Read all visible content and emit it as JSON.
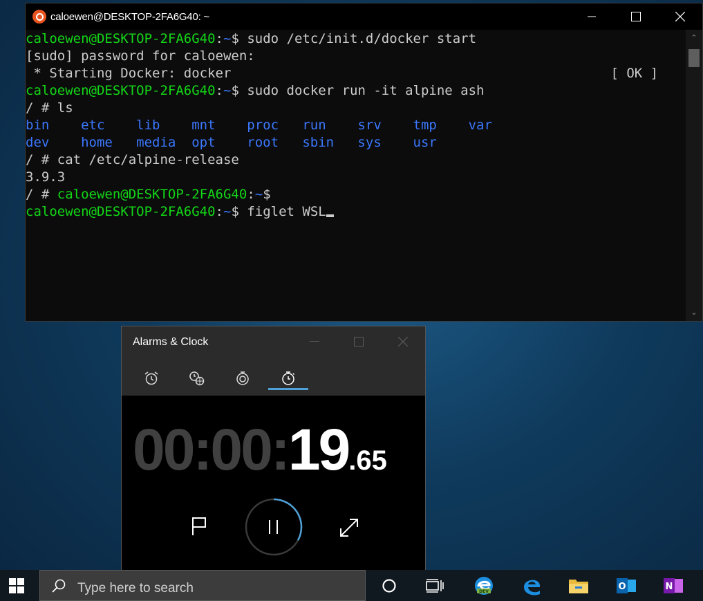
{
  "terminal": {
    "title": "caloewen@DESKTOP-2FA6G40: ~",
    "lines": [
      {
        "parts": [
          {
            "c": "g",
            "t": "caloewen@DESKTOP-2FA6G40"
          },
          {
            "c": "w",
            "t": ":"
          },
          {
            "c": "b",
            "t": "~"
          },
          {
            "c": "w",
            "t": "$ sudo /etc/init.d/docker start"
          }
        ]
      },
      {
        "parts": [
          {
            "c": "w",
            "t": "[sudo] password for caloewen:"
          }
        ]
      },
      {
        "parts": [
          {
            "c": "w",
            "t": " * Starting Docker: docker                                                [ OK ]"
          }
        ]
      },
      {
        "parts": [
          {
            "c": "g",
            "t": "caloewen@DESKTOP-2FA6G40"
          },
          {
            "c": "w",
            "t": ":"
          },
          {
            "c": "b",
            "t": "~"
          },
          {
            "c": "w",
            "t": "$ sudo docker run -it alpine ash"
          }
        ]
      },
      {
        "parts": [
          {
            "c": "w",
            "t": "/ # ls"
          }
        ]
      },
      {
        "parts": [
          {
            "c": "b",
            "t": "bin    etc    lib    mnt    proc   run    srv    tmp    var"
          }
        ]
      },
      {
        "parts": [
          {
            "c": "b",
            "t": "dev    home   media  opt    root   sbin   sys    usr"
          }
        ]
      },
      {
        "parts": [
          {
            "c": "w",
            "t": "/ # cat /etc/alpine-release"
          }
        ]
      },
      {
        "parts": [
          {
            "c": "w",
            "t": "3.9.3"
          }
        ]
      },
      {
        "parts": [
          {
            "c": "w",
            "t": "/ # "
          },
          {
            "c": "g",
            "t": "caloewen@DESKTOP-2FA6G40"
          },
          {
            "c": "w",
            "t": ":"
          },
          {
            "c": "b",
            "t": "~"
          },
          {
            "c": "w",
            "t": "$"
          }
        ]
      },
      {
        "parts": [
          {
            "c": "g",
            "t": "caloewen@DESKTOP-2FA6G40"
          },
          {
            "c": "w",
            "t": ":"
          },
          {
            "c": "b",
            "t": "~"
          },
          {
            "c": "w",
            "t": "$ figlet WSL"
          }
        ],
        "cursor": true
      }
    ],
    "colors": {
      "prompt_green": "#13d617",
      "path_blue": "#3b78ff",
      "text": "#cccccc",
      "background": "#0c0c0c"
    }
  },
  "alarms_clock": {
    "title": "Alarms & Clock",
    "tabs": [
      {
        "icon": "alarm-clock-icon"
      },
      {
        "icon": "world-clock-icon"
      },
      {
        "icon": "timer-icon"
      },
      {
        "icon": "stopwatch-icon",
        "active": true
      }
    ],
    "stopwatch": {
      "hours_minutes_prefix": "00:00:",
      "seconds": "19",
      "fraction": ".65",
      "progress": 0.33
    },
    "controls": {
      "lap": "flag-icon",
      "pause": "pause-icon",
      "expand": "expand-icon"
    },
    "accent": "#4ea1d8"
  },
  "taskbar": {
    "search_placeholder": "Type here to search",
    "icons": [
      "cortana-icon",
      "task-view-icon",
      "edge-dev-icon",
      "edge-icon",
      "file-explorer-icon",
      "outlook-icon",
      "onenote-icon"
    ]
  }
}
